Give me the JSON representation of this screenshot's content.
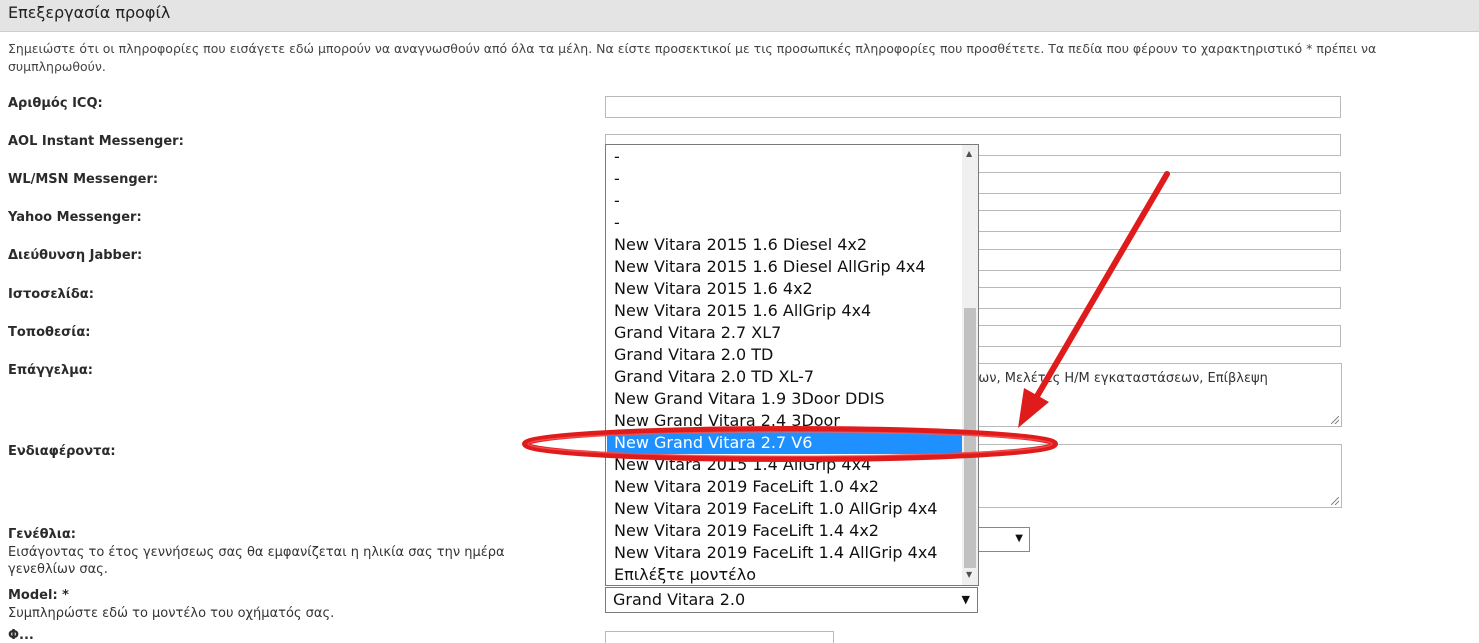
{
  "header": {
    "title": "Επεξεργασία προφίλ"
  },
  "notice": "Σημειώστε ότι οι πληροφορίες που εισάγετε εδώ μπορούν να αναγνωσθούν από όλα τα μέλη. Να είστε προσεκτικοί με τις προσωπικές πληροφορίες που προσθέτετε. Τα πεδία που φέρουν το χαρακτηριστικό * πρέπει να συμπληρωθούν.",
  "fields": {
    "icq": "Αριθμός ICQ:",
    "aol": "AOL Instant Messenger:",
    "msn": "WL/MSN Messenger:",
    "yahoo": "Yahoo Messenger:",
    "jabber": "Διεύθυνση Jabber:",
    "website": "Ιστοσελίδα:",
    "location": "Τοποθεσία:",
    "occupation": "Επάγγελμα:",
    "occupation_value": "ίων, Μελέτες Η/Μ εγκαταστάσεων, Επίβλεψη",
    "interests": "Ενδιαφέροντα:",
    "birthday": "Γενέθλια:",
    "birthday_help": "Εισάγοντας το έτος γεννήσεως σας θα εμφανίζεται η ηλικία σας την ημέρα γενεθλίων σας.",
    "model": "Model: *",
    "model_help": "Συμπληρώστε εδώ το μοντέλο του οχήματός σας.",
    "next_cut": "Φ..."
  },
  "model_select": {
    "current_value": "Grand Vitara 2.0",
    "options": [
      "-",
      "-",
      "-",
      "-",
      "New Vitara 2015 1.6 Diesel 4x2",
      "New Vitara 2015 1.6 Diesel AllGrip 4x4",
      "New Vitara 2015 1.6 4x2",
      "New Vitara 2015 1.6 AllGrip 4x4",
      "Grand Vitara 2.7 XL7",
      "Grand Vitara 2.0 TD",
      "Grand Vitara 2.0 TD XL-7",
      "New Grand Vitara 1.9 3Door DDIS",
      "New Grand Vitara 2.4 3Door",
      "New Grand Vitara 2.7 V6",
      "New Vitara 2015 1.4 AllGrip 4x4",
      "New Vitara 2019 FaceLift 1.0 4x2",
      "New Vitara 2019 FaceLift 1.0 AllGrip 4x4",
      "New Vitara 2019 FaceLift 1.4 4x2",
      "New Vitara 2019 FaceLift 1.4 AllGrip 4x4",
      "Επιλέξτε μοντέλο"
    ],
    "highlighted_index": 13
  },
  "colors": {
    "highlight": "#1e90ff",
    "annotation": "#e01b1b"
  },
  "icons": {
    "dropdown": "chevron-down-icon",
    "scroll_up": "scroll-up-icon",
    "scroll_down": "scroll-down-icon"
  }
}
